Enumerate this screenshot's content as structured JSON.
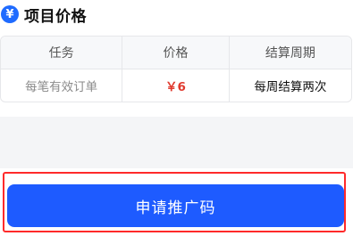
{
  "section": {
    "icon_glyph": "¥",
    "title": "项目价格"
  },
  "table": {
    "headers": [
      "任务",
      "价格",
      "结算周期"
    ],
    "rows": [
      [
        "每笔有效订单",
        "￥6",
        "每周结算两次"
      ]
    ]
  },
  "cta": {
    "label": "申请推广码"
  },
  "colors": {
    "brand_blue": "#1e5bff",
    "price_red": "#e03a2e",
    "highlight_red": "#ff2a2a"
  }
}
